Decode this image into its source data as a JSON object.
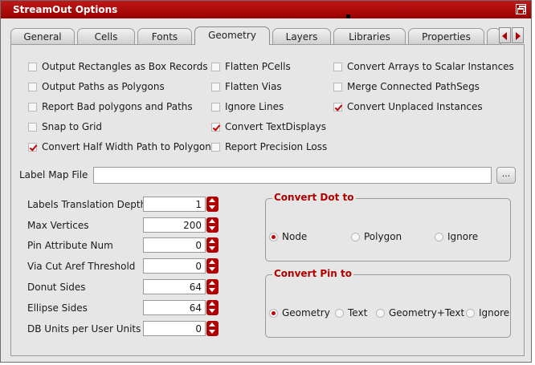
{
  "window": {
    "title": "StreamOut Options"
  },
  "tabs": [
    "General",
    "Cells",
    "Fonts",
    "Geometry",
    "Layers",
    "Libraries",
    "Properties"
  ],
  "active_tab": "Geometry",
  "checkboxes": {
    "col1": [
      {
        "label": "Output Rectangles as Box Records",
        "checked": false
      },
      {
        "label": "Output Paths as Polygons",
        "checked": false
      },
      {
        "label": "Report Bad polygons and Paths",
        "checked": false
      },
      {
        "label": "Snap to Grid",
        "checked": false
      },
      {
        "label": "Convert Half Width Path to Polygon",
        "checked": true
      }
    ],
    "col2": [
      {
        "label": "Flatten PCells",
        "checked": false
      },
      {
        "label": "Flatten Vias",
        "checked": false
      },
      {
        "label": "Ignore Lines",
        "checked": false
      },
      {
        "label": "Convert TextDisplays",
        "checked": true
      },
      {
        "label": "Report Precision Loss",
        "checked": false
      }
    ],
    "col3": [
      {
        "label": "Convert Arrays to Scalar Instances",
        "checked": false
      },
      {
        "label": "Merge Connected PathSegs",
        "checked": false
      },
      {
        "label": "Convert Unplaced Instances",
        "checked": true
      }
    ]
  },
  "label_map": {
    "label": "Label Map File",
    "value": "",
    "browse_label": "..."
  },
  "numeric_fields": [
    {
      "label": "Labels Translation Depth",
      "value": "1"
    },
    {
      "label": "Max Vertices",
      "value": "200"
    },
    {
      "label": "Pin Attribute Num",
      "value": "0"
    },
    {
      "label": "Via Cut Aref Threshold",
      "value": "0"
    },
    {
      "label": "Donut Sides",
      "value": "64"
    },
    {
      "label": "Ellipse Sides",
      "value": "64"
    },
    {
      "label": "DB Units per User Units",
      "value": "0"
    }
  ],
  "convert_dot": {
    "title": "Convert Dot to",
    "options": [
      "Node",
      "Polygon",
      "Ignore"
    ],
    "selected": "Node"
  },
  "convert_pin": {
    "title": "Convert Pin to",
    "options": [
      "Geometry",
      "Text",
      "Geometry+Text",
      "Ignore"
    ],
    "selected": "Geometry"
  },
  "colors": {
    "accent": "#b00000",
    "title_bar": "#b00000",
    "panel_bg": "#e6e6e6"
  }
}
